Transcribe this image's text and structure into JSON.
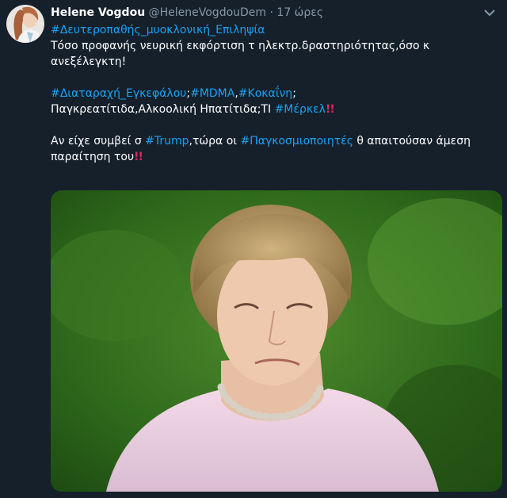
{
  "author": {
    "name": "Helene Vogdou",
    "handle": "@HeleneVogdouDem",
    "separator": "·",
    "time": "17 ώρες"
  },
  "icons": {
    "menu": "chevron-down-icon",
    "avatar": "avatar-photo"
  },
  "tweet": {
    "line1": {
      "tag": "#Δευτεροπαθής_μυοκλονική_Επιληψία"
    },
    "line2": {
      "text": "Τόσο προφανής νευρική εκφόρτιση τ ηλεκτρ.δραστηριότητας,όσο κ"
    },
    "line3": {
      "text": "ανεξέλεγκτη!"
    },
    "line4": {
      "tag1": "#Διαταραχή_Εγκεφάλου",
      "sep1": ";",
      "tag2": "#MDMA",
      "sep2": ",",
      "tag3": "#Κοκαΐνη",
      "end": ";"
    },
    "line5": {
      "text": "Παγκρεατίτιδα,Αλκοολική Ηπατίτιδα;ΤΙ ",
      "tag": "#Μέρκελ",
      "emoji": "!!"
    },
    "line6": {
      "a": "Αν είχε συμβεί σ ",
      "tag1": "#Trump",
      "b": ",τώρα οι ",
      "tag2": "#Παγκοσμιοποιητές",
      "c": " θ απαιτούσαν άμεση"
    },
    "line7": {
      "text": "παραίτηση του",
      "emoji": "!!"
    }
  },
  "colors": {
    "background": "#15202b",
    "hashtag": "#1da1f2",
    "muted": "#8899a6",
    "emoji": "#e0245e"
  }
}
